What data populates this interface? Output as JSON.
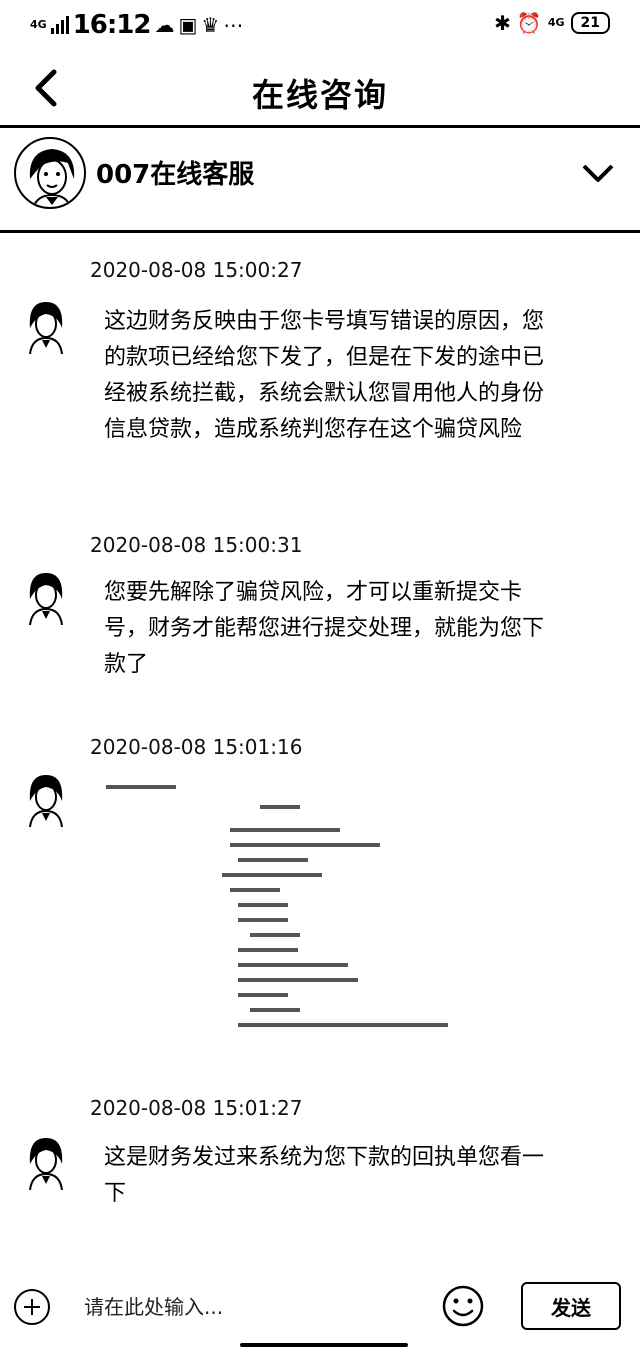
{
  "status_bar": {
    "network": "4G",
    "time": "16:12",
    "right_network": "4G",
    "battery": "21"
  },
  "header": {
    "title": "在线咨询"
  },
  "agent": {
    "name": "007在线客服"
  },
  "messages": [
    {
      "time": "2020-08-08 15:00:27",
      "text": "这边财务反映由于您卡号填写错误的原因，您的款项已经给您下发了，但是在下发的途中已经被系统拦截，系统会默认您冒用他人的身份信息贷款，造成系统判您存在这个骗贷风险"
    },
    {
      "time": "2020-08-08 15:00:31",
      "text": "您要先解除了骗贷风险，才可以重新提交卡号，财务才能帮您进行提交处理，就能为您下款了"
    },
    {
      "time": "2020-08-08 15:01:16",
      "image": "receipt-image"
    },
    {
      "time": "2020-08-08 15:01:27",
      "text": "这是财务发过来系统为您下款的回执单您看一下"
    }
  ],
  "input": {
    "placeholder": "请在此处输入...",
    "send_label": "发送"
  }
}
